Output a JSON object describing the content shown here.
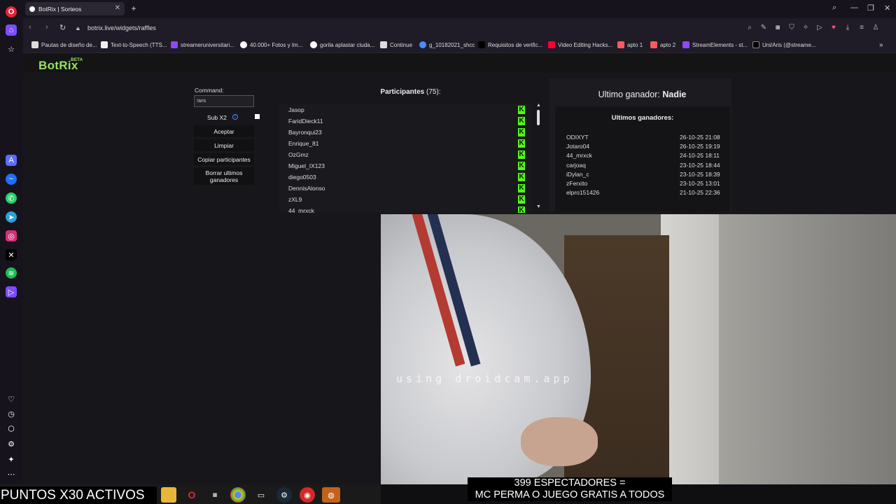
{
  "browser": {
    "tab_title": "BotRix | Sorteos",
    "url": "botrix.live/widgets/raffles",
    "bookmarks": [
      "Pautas de diseño de...",
      "Text-to-Speech (TTS...",
      "streameruniversitari...",
      "40.000+ Fotos y Im...",
      "gorila aplastar ciuda...",
      "Continue",
      "g_10182021_shcc",
      "Requisitos de verific...",
      "Video Editing Hacks...",
      "apto 1",
      "apto 2",
      "StreamElements - st...",
      "Uni/Aris (@streame..."
    ]
  },
  "botrix": {
    "logo": "BotRix",
    "logo_badge": "BETA",
    "command_label": "Command:",
    "command_value": "!aris",
    "sub_label": "Sub X2",
    "buttons": {
      "accept": "Aceptar",
      "clear": "Limpiar",
      "copy": "Copiar participantes",
      "delete_last": "Borrar ultimos ganadores"
    },
    "participants_title": "Participantes",
    "participants_count": "(75):",
    "participants": [
      "Jasop",
      "FaridDieck11",
      "Bayronqui23",
      "Enrique_81",
      "OzGmz",
      "Miguel_IX123",
      "diego0503",
      "DennisAlonso",
      "zXL9",
      "44_mrxck"
    ],
    "platform_badge": "K",
    "last_winner_label": "Ultimo ganador:",
    "last_winner_value": "Nadie",
    "recent_winners_title": "Ultimos ganadores:",
    "recent_winners": [
      {
        "name": "ODIXYT",
        "date": "26-10-25 21:08"
      },
      {
        "name": "Jotaro04",
        "date": "26-10-25 19:19"
      },
      {
        "name": "44_mrxck",
        "date": "24-10-25 18:11"
      },
      {
        "name": "carjoaq",
        "date": "23-10-25 18:44"
      },
      {
        "name": "iDylan_c",
        "date": "23-10-25 18:39"
      },
      {
        "name": "zFerxito",
        "date": "23-10-25 13:01"
      },
      {
        "name": "elpro151426",
        "date": "21-10-25 22:36"
      }
    ]
  },
  "stream": {
    "camera_watermark": "using droidcam.app",
    "viewers_line1": "399 ESPECTADORES =",
    "viewers_line2": "MC PERMA O JUEGO GRATIS A TODOS",
    "points_banner": "PUNTOS X30 ACTIVOS"
  },
  "colors": {
    "accent_green": "#9be060",
    "kick_green": "#53fc18",
    "opera_red": "#e0263a",
    "opera_purple": "#7b4dff"
  }
}
